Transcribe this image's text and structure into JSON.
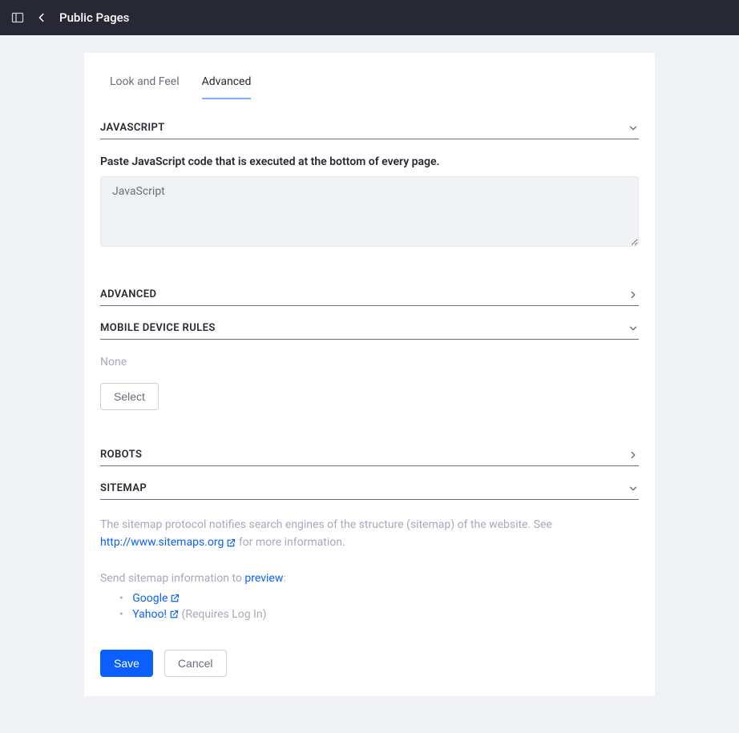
{
  "header": {
    "title": "Public Pages"
  },
  "tabs": {
    "look_and_feel": "Look and Feel",
    "advanced": "Advanced"
  },
  "sections": {
    "javascript": {
      "title": "JAVASCRIPT",
      "field_label": "Paste JavaScript code that is executed at the bottom of every page.",
      "placeholder": "JavaScript"
    },
    "advanced": {
      "title": "ADVANCED"
    },
    "mobile_device_rules": {
      "title": "MOBILE DEVICE RULES",
      "none_text": "None",
      "select_button": "Select"
    },
    "robots": {
      "title": "ROBOTS"
    },
    "sitemap": {
      "title": "SITEMAP",
      "description_prefix": "The sitemap protocol notifies search engines of the structure (sitemap) of the website. See ",
      "sitemaps_link": "http://www.sitemaps.org",
      "description_suffix": " for more information.",
      "send_prefix": "Send sitemap information to ",
      "preview_link": "preview",
      "send_suffix": ":",
      "google_link": "Google",
      "yahoo_link": "Yahoo!",
      "yahoo_note": " (Requires Log In)"
    }
  },
  "buttons": {
    "save": "Save",
    "cancel": "Cancel"
  }
}
